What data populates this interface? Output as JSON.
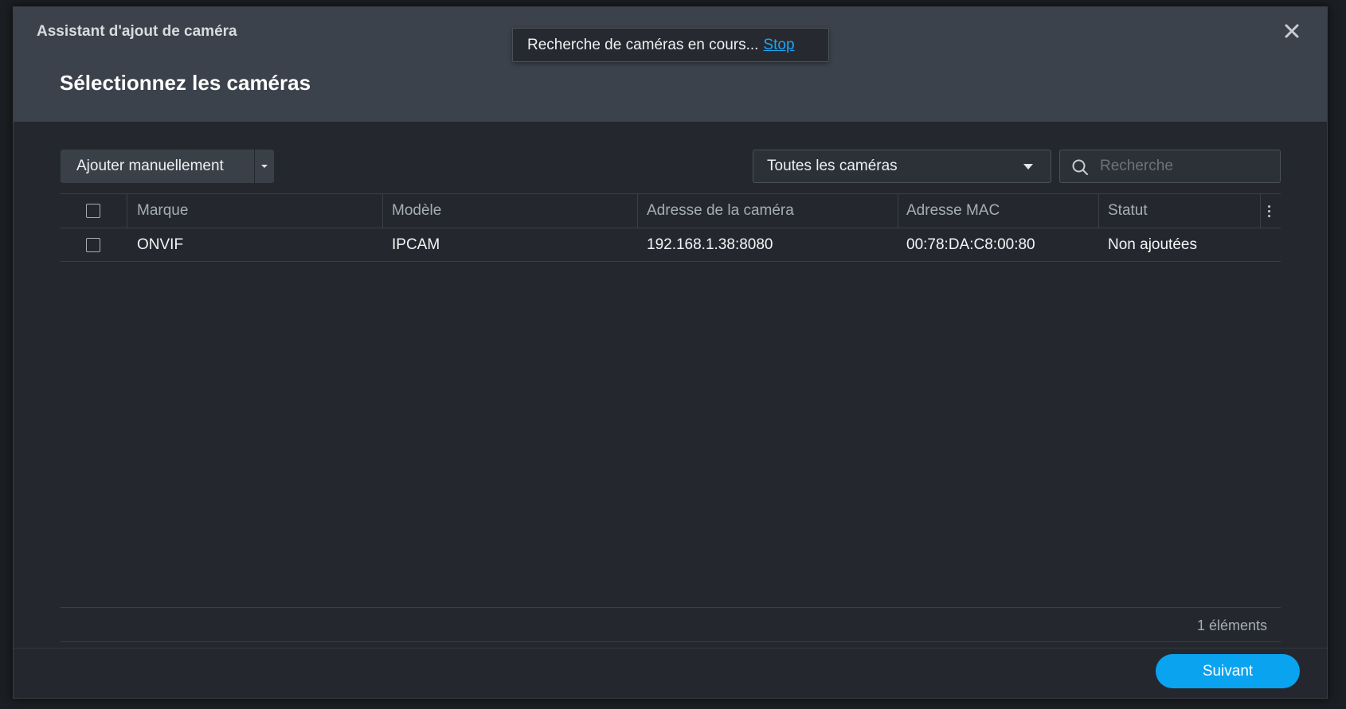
{
  "window": {
    "title": "Assistant d'ajout de caméra"
  },
  "page": {
    "title": "Sélectionnez les caméras"
  },
  "toast": {
    "message": "Recherche de caméras en cours...",
    "stop_label": "Stop"
  },
  "toolbar": {
    "add_manual_label": "Ajouter manuellement",
    "filter_selected": "Toutes les caméras",
    "search_placeholder": "Recherche"
  },
  "table": {
    "headers": [
      "Marque",
      "Modèle",
      "Adresse de la caméra",
      "Adresse MAC",
      "Statut"
    ],
    "rows": [
      {
        "brand": "ONVIF",
        "model": "IPCAM",
        "address": "192.168.1.38:8080",
        "mac": "00:78:DA:C8:00:80",
        "status": "Non ajoutées",
        "checked": false
      }
    ],
    "count_label": "1 éléments"
  },
  "footer": {
    "next_label": "Suivant"
  },
  "colors": {
    "accent": "#0aa3ef",
    "link": "#1fa4f2",
    "header_bg": "#3b424b",
    "body_bg": "#24282e"
  },
  "icons": {
    "close": "close-icon",
    "search": "search-icon",
    "more": "more-vertical-icon",
    "caret": "caret-down-icon"
  }
}
